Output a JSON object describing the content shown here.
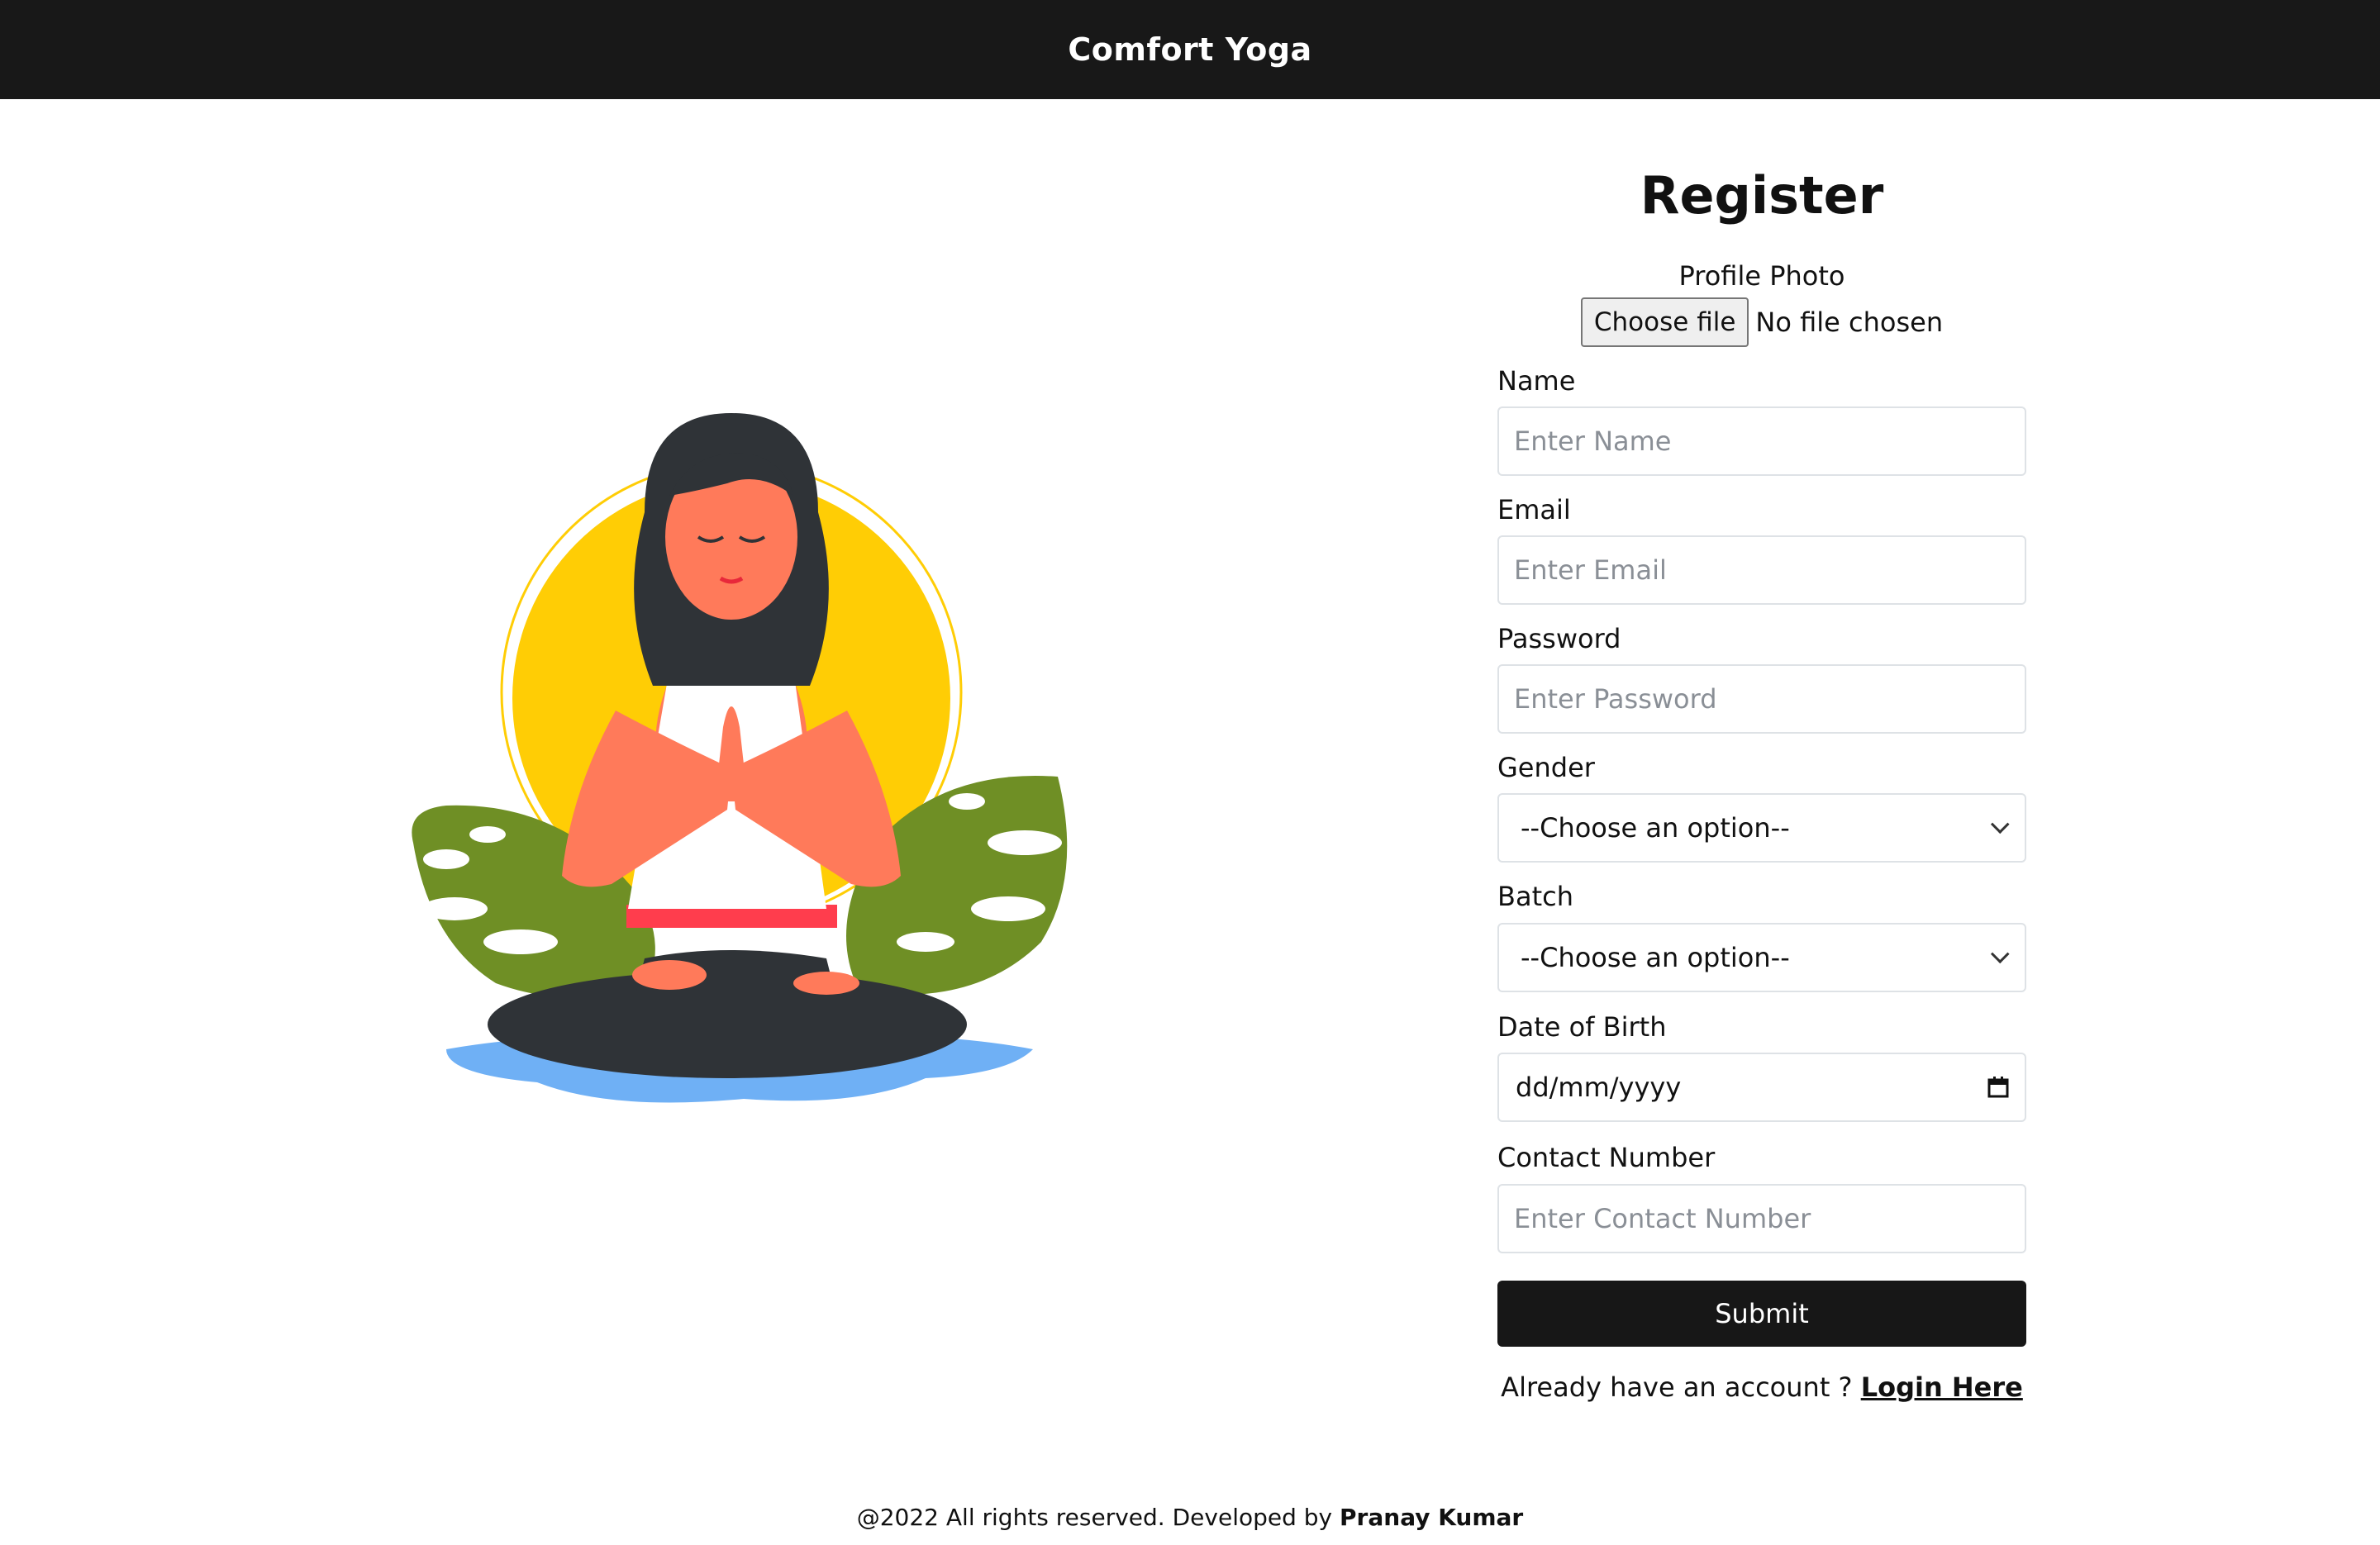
{
  "navbar": {
    "brand": "Comfort Yoga"
  },
  "form": {
    "title": "Register",
    "photo_label": "Profile Photo",
    "file_button": "Choose file",
    "file_status": "No file chosen",
    "fields": {
      "name": {
        "label": "Name",
        "placeholder": "Enter Name"
      },
      "email": {
        "label": "Email",
        "placeholder": "Enter Email"
      },
      "password": {
        "label": "Password",
        "placeholder": "Enter Password"
      },
      "gender": {
        "label": "Gender",
        "value": "--Choose an option--"
      },
      "batch": {
        "label": "Batch",
        "value": "--Choose an option--"
      },
      "dob": {
        "label": "Date of Birth",
        "value": "dd/mm/yyyy"
      },
      "contact": {
        "label": "Contact Number",
        "placeholder": "Enter Contact Number"
      }
    },
    "submit_label": "Submit",
    "login_prompt": "Already have an account ?",
    "login_link": "Login Here"
  },
  "footer": {
    "text": "@2022 All rights reserved. Developed by",
    "author": "Pranay Kumar"
  },
  "colors": {
    "navbar": "#181818",
    "submit": "#171717",
    "sun": "#ffcd05",
    "leaf": "#6f8f25",
    "water": "#6fb0f5"
  },
  "illustration": {
    "icon": "yoga-meditation-illustration"
  }
}
